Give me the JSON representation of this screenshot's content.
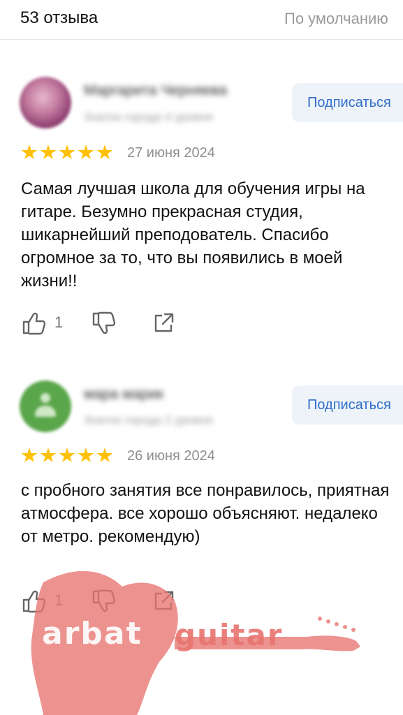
{
  "header": {
    "count_label": "53 отзыва",
    "sort_label": "По умолчанию"
  },
  "reviews": [
    {
      "name": "Маргарита Черняева",
      "meta": "Знаток города 4 уровня",
      "subscribe_label": "Подписаться",
      "rating": 5,
      "date": "27 июня 2024",
      "text": "Самая лучшая школа для обучения игры на гитаре. Безумно прекрасная студия, шикарнейший преподователь. Спасибо огромное за то, что вы появились в моей жизни!!",
      "likes": "1"
    },
    {
      "name": "мара марик",
      "meta": "Знаток города 2 уровня",
      "subscribe_label": "Подписаться",
      "rating": 5,
      "date": "26 июня 2024",
      "text": "с пробного занятия все понравилось, приятная атмосфера. все хорошо объясняют. недалеко от метро. рекомендую)",
      "likes": "1"
    }
  ],
  "watermark": {
    "text": "arbat guitar"
  },
  "colors": {
    "accent": "#2f6ec8",
    "star": "#ffc107",
    "watermark": "#e8746f"
  }
}
